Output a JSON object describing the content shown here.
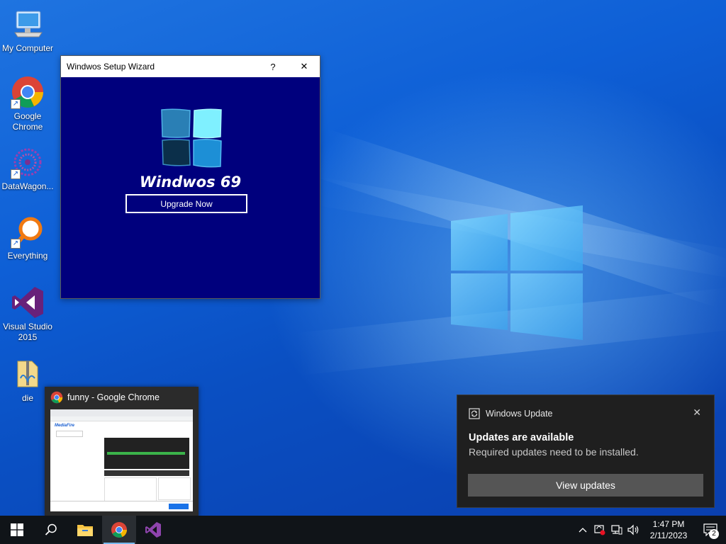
{
  "desktop": {
    "icons": [
      {
        "label": "My Computer"
      },
      {
        "label": "Google Chrome"
      },
      {
        "label": "DataWagon..."
      },
      {
        "label": "Everything"
      },
      {
        "label": "Visual Studio 2015"
      },
      {
        "label": "die"
      }
    ]
  },
  "wizard": {
    "title": "Windwos Setup Wizard",
    "help": "?",
    "close": "✕",
    "product_name": "Windwos 69",
    "upgrade_label": "Upgrade Now"
  },
  "preview": {
    "title": "funny - Google Chrome",
    "thumb_site": "MediaFire"
  },
  "toast": {
    "app": "Windows Update",
    "heading": "Updates are available",
    "message": "Required updates need to be installed.",
    "button": "View updates",
    "close": "✕"
  },
  "taskbar": {
    "time": "1:47 PM",
    "date": "2/11/2023",
    "notification_count": "2"
  },
  "colors": {
    "wizard_bg": "#00007d",
    "accent": "#76b9ed",
    "toast_bg": "#1f1f1f"
  }
}
